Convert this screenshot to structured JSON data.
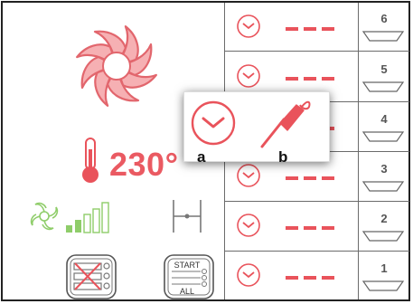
{
  "colors": {
    "accent": "#e9535b",
    "fan": "#ec8a8e",
    "fan_stroke": "#e2666d",
    "green": "#8fcd6a",
    "border": "#6b6b6b",
    "text_dark": "#222222"
  },
  "left_panel": {
    "temperature": "230°",
    "fan_icon": "fan-icon",
    "thermometer_icon": "thermometer-icon",
    "fan_speed_icon": "fan-speed-icon",
    "fan_speed_level": 5,
    "fan_speed_max": 5,
    "gap_icon": "gap-width-icon",
    "multi_shelf_button_icon": "multi-shelf-icon",
    "start_all_button": {
      "top": "START",
      "bottom": "ALL"
    }
  },
  "shelves": [
    {
      "number": "6"
    },
    {
      "number": "5"
    },
    {
      "number": "4"
    },
    {
      "number": "3"
    },
    {
      "number": "2"
    },
    {
      "number": "1"
    }
  ],
  "popup": {
    "option_a_label": "a",
    "option_b_label": "b",
    "option_a_icon": "timer-icon",
    "option_b_icon": "probe-icon"
  }
}
